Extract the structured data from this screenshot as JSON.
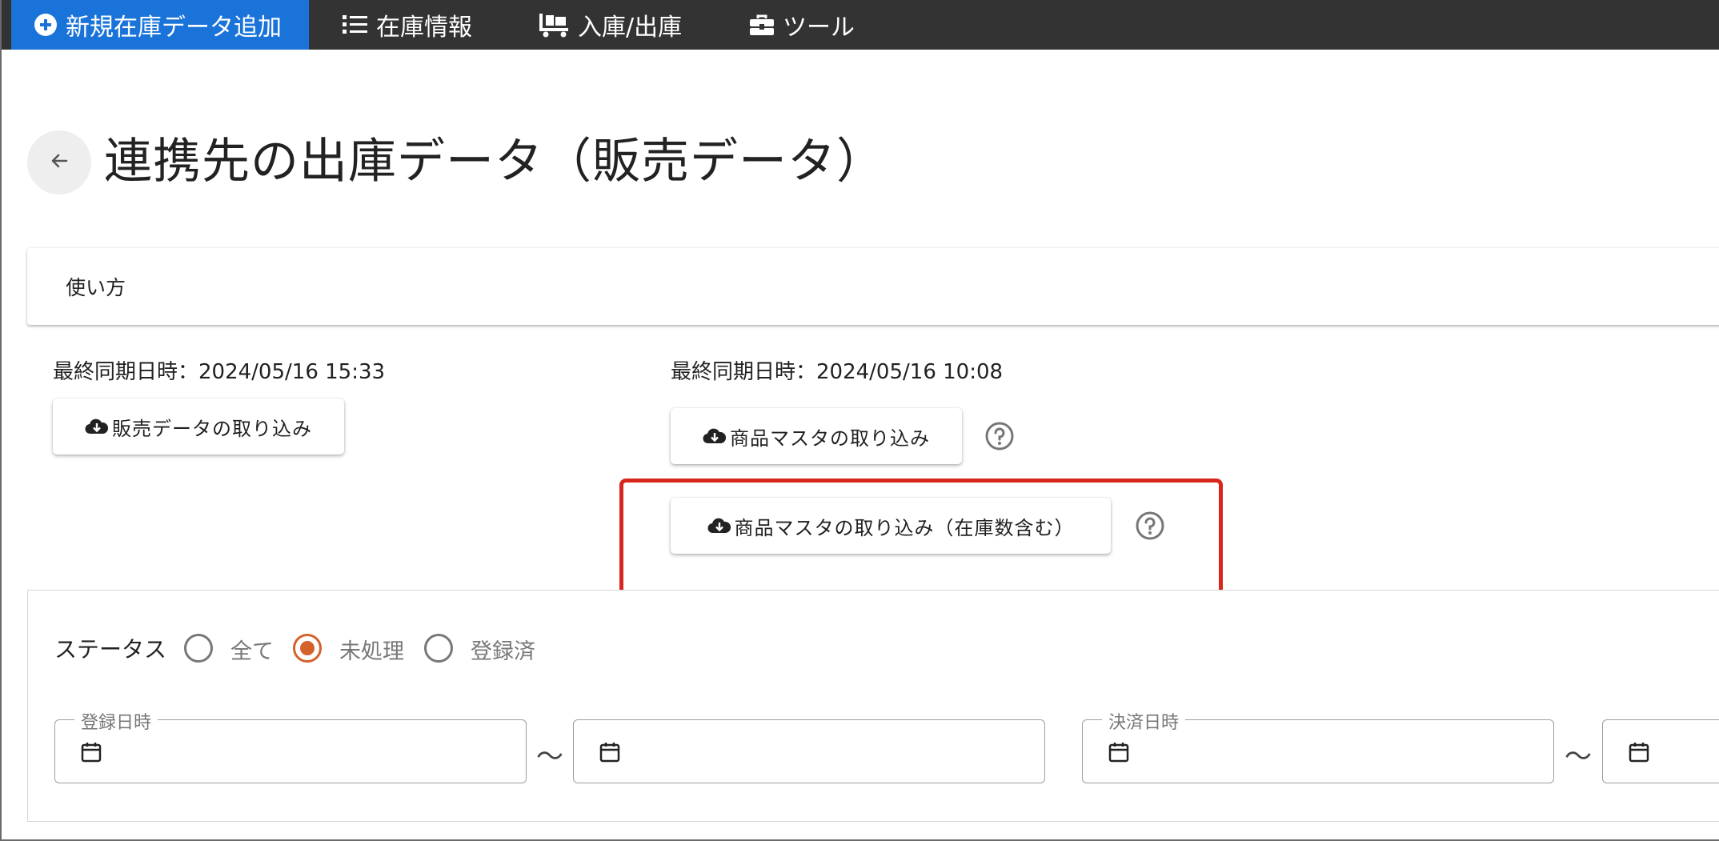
{
  "nav": {
    "items": [
      {
        "label": "新規在庫データ追加",
        "icon": "plus-circle-icon"
      },
      {
        "label": "在庫情報",
        "icon": "list-icon"
      },
      {
        "label": "入庫/出庫",
        "icon": "pallet-icon"
      },
      {
        "label": "ツール",
        "icon": "toolbox-icon"
      }
    ],
    "active_color": "#1a73d9",
    "bg_color": "#333333"
  },
  "page": {
    "title": "連携先の出庫データ（販売データ）",
    "back_icon": "arrow-left-icon"
  },
  "usage": {
    "label": "使い方"
  },
  "sync_left": {
    "last_sync": "最終同期日時：2024/05/16 15:33",
    "button_label": "販売データの取り込み",
    "button_icon": "cloud-download-icon"
  },
  "sync_right": {
    "last_sync": "最終同期日時：2024/05/16 10:08",
    "master_button_label": "商品マスタの取り込み",
    "master_stock_button_label": "商品マスタの取り込み（在庫数含む）",
    "button_icon": "cloud-download-icon",
    "help_icon": "help-circle-icon"
  },
  "highlight_color": "#d9261c",
  "filter": {
    "status_label": "ステータス",
    "options": [
      {
        "label": "全て",
        "checked": false
      },
      {
        "label": "未処理",
        "checked": true
      },
      {
        "label": "登録済",
        "checked": false
      }
    ],
    "registered_date_label": "登録日時",
    "payment_date_label": "決済日時",
    "range_separator": "〜",
    "calendar_icon": "calendar-icon",
    "accent_color": "#d4622a"
  }
}
